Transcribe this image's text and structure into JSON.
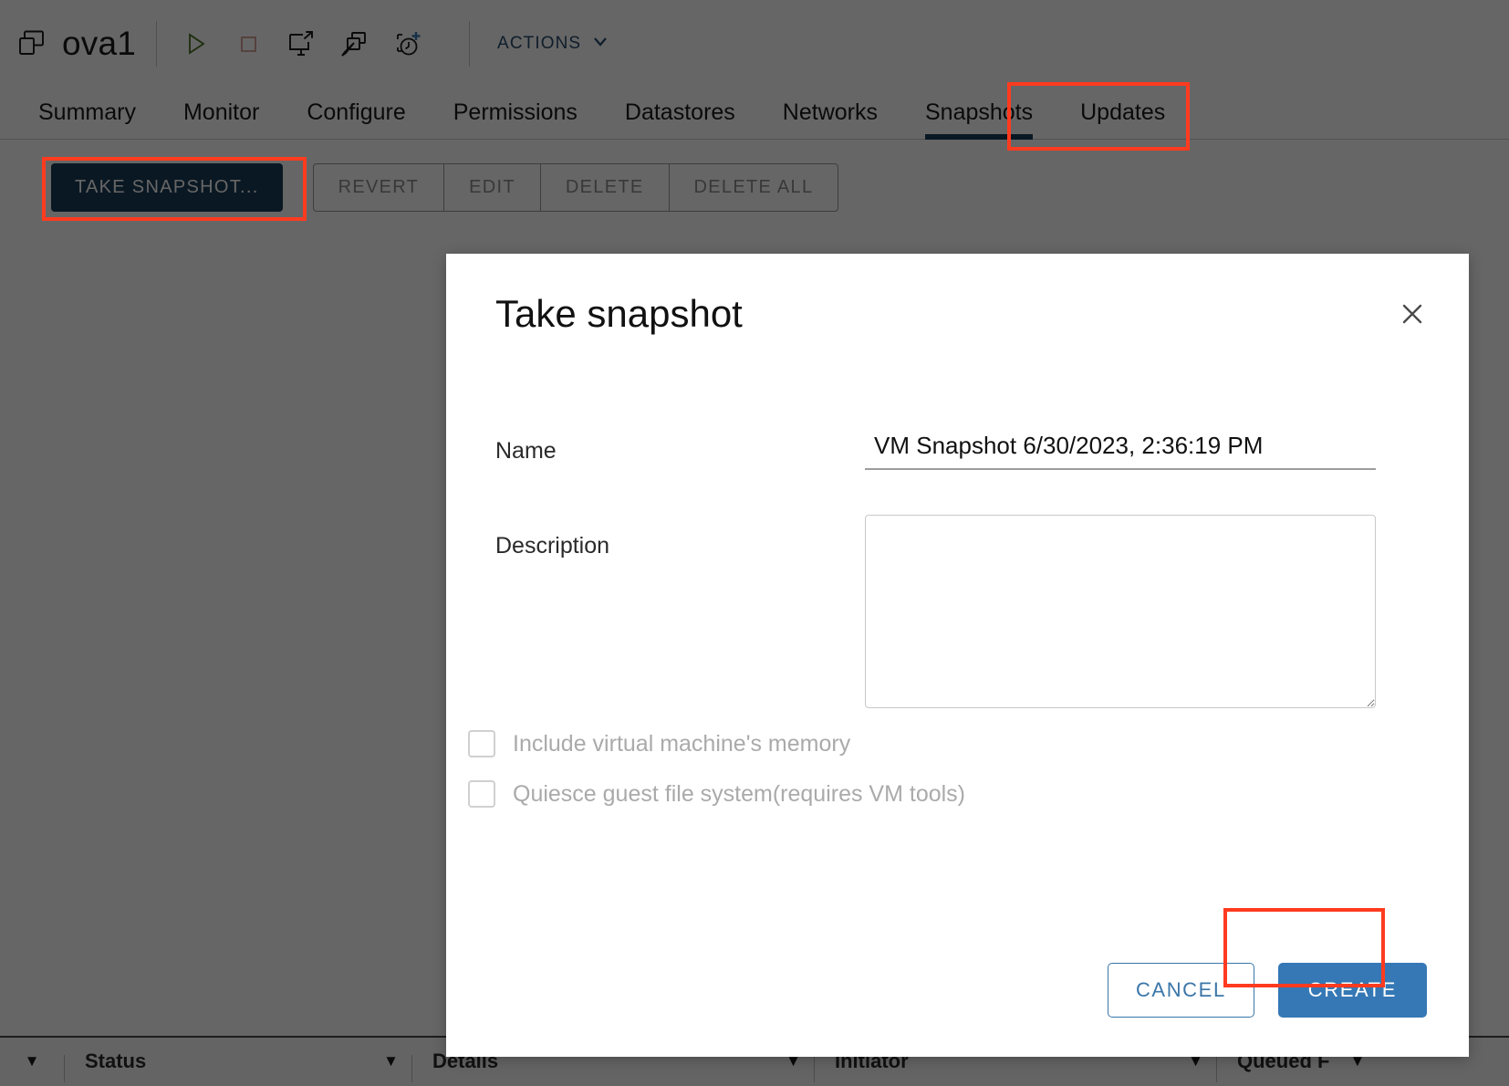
{
  "colors": {
    "accent_dark": "#1b3c57",
    "accent_blue": "#3578b5",
    "link_blue": "#274a6d",
    "annotation_red": "#ff3b1f",
    "overlay": "rgba(0,0,0,0.60)"
  },
  "header": {
    "object_icon": "virtual-machine-icon",
    "title": "ova1",
    "actions_label": "ACTIONS",
    "actions_caret": "chevron-down-icon",
    "toolbar_icons": [
      {
        "name": "power-on-icon",
        "title": "Power On"
      },
      {
        "name": "power-off-icon",
        "title": "Power Off"
      },
      {
        "name": "launch-web-console-icon",
        "title": "Launch Web Console"
      },
      {
        "name": "edit-vm-icon",
        "title": "Edit Virtual Machine"
      },
      {
        "name": "take-snapshot-icon",
        "title": "Take Snapshot"
      }
    ]
  },
  "tabs": [
    {
      "label": "Summary",
      "active": false
    },
    {
      "label": "Monitor",
      "active": false
    },
    {
      "label": "Configure",
      "active": false
    },
    {
      "label": "Permissions",
      "active": false
    },
    {
      "label": "Datastores",
      "active": false
    },
    {
      "label": "Networks",
      "active": false
    },
    {
      "label": "Snapshots",
      "active": true
    },
    {
      "label": "Updates",
      "active": false
    }
  ],
  "toolbar": {
    "take_snapshot_label": "TAKE SNAPSHOT...",
    "secondary_buttons": [
      {
        "label": "REVERT",
        "disabled": true
      },
      {
        "label": "EDIT",
        "disabled": true
      },
      {
        "label": "DELETE",
        "disabled": true
      },
      {
        "label": "DELETE ALL",
        "disabled": true
      }
    ]
  },
  "dialog": {
    "title": "Take snapshot",
    "close_icon": "close-icon",
    "name_label": "Name",
    "name_value": "VM Snapshot 6/30/2023, 2:36:19 PM",
    "name_placeholder": "",
    "description_label": "Description",
    "description_value": "",
    "description_placeholder": "",
    "checkboxes": [
      {
        "label": "Include virtual machine's memory",
        "checked": false,
        "disabled": true
      },
      {
        "label": "Quiesce guest file system(requires VM tools)",
        "checked": false,
        "disabled": true
      }
    ],
    "cancel_label": "CANCEL",
    "create_label": "CREATE"
  },
  "tasks_panel": {
    "columns": [
      {
        "label": "Status",
        "caret": "filter-caret-icon"
      },
      {
        "label": "Details",
        "caret": "filter-caret-icon"
      },
      {
        "label": "Initiator",
        "caret": "filter-caret-icon"
      },
      {
        "label": "Queued F",
        "caret": "filter-caret-icon"
      }
    ]
  },
  "annotations": [
    {
      "name": "annotation-snapshots-tab"
    },
    {
      "name": "annotation-take-snapshot-button"
    },
    {
      "name": "annotation-create-button"
    }
  ]
}
